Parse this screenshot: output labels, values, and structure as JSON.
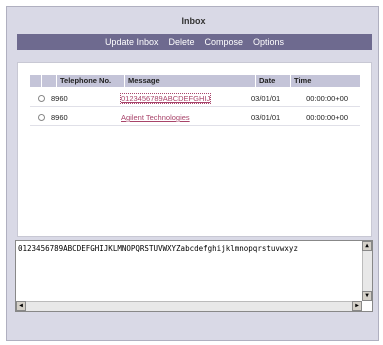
{
  "window": {
    "title": "Inbox"
  },
  "menu": {
    "update_inbox": "Update Inbox",
    "delete": "Delete",
    "compose": "Compose",
    "options": "Options"
  },
  "table": {
    "columns": [
      "Telephone No.",
      "Message",
      "Date",
      "Time"
    ],
    "rows": [
      {
        "tel": "8960",
        "message": "0123456789ABCDEFGHIJ",
        "date": "03/01/01",
        "time": "00:00:00+00"
      },
      {
        "tel": "8960",
        "message": "Agilent Technologies",
        "date": "03/01/01",
        "time": "00:00:00+00"
      }
    ]
  },
  "message_view": {
    "text": "0123456789ABCDEFGHIJKLMNOPQRSTUVWXYZabcdefghijklmnopqrstuvwxyz"
  },
  "icons": {
    "scroll_up": "▲",
    "scroll_down": "▼",
    "scroll_left": "◀",
    "scroll_right": "▶"
  },
  "colors": {
    "menubar": "#6e6a8f",
    "link": "#a8446a",
    "header": "#c4c4d8"
  }
}
